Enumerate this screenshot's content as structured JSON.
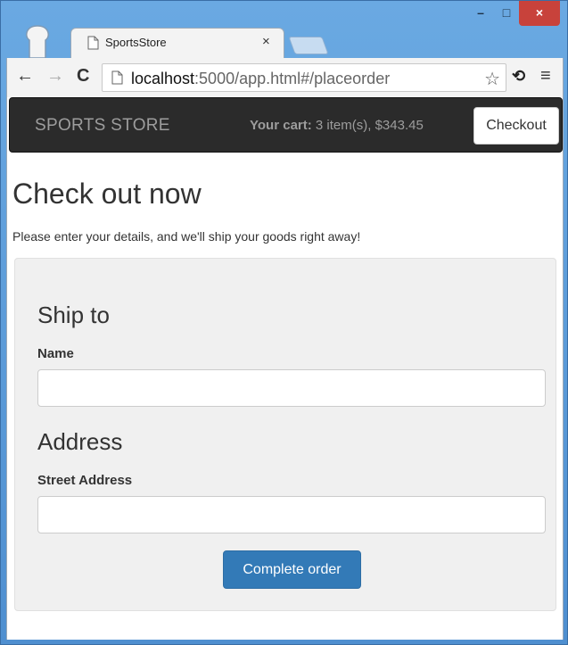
{
  "browser": {
    "tab_title": "SportsStore",
    "tab_close": "×",
    "url_host": "localhost",
    "url_path": ":5000/app.html#/placeorder",
    "window_close": "×",
    "window_min": "–",
    "window_max": "□"
  },
  "icons": {
    "back": "←",
    "forward": "→",
    "reload": "C",
    "star": "☆",
    "extension": "⟲",
    "menu": "≡"
  },
  "navbar": {
    "brand": "SPORTS STORE",
    "cart_label": "Your cart:",
    "cart_summary": " 3 item(s), $343.45",
    "checkout_label": "Checkout"
  },
  "page": {
    "heading": "Check out now",
    "lead": "Please enter your details, and we'll ship your goods right away!"
  },
  "form": {
    "ship_heading": "Ship to",
    "name_label": "Name",
    "name_value": "",
    "address_heading": "Address",
    "street_label": "Street Address",
    "street_value": "",
    "submit_label": "Complete order"
  },
  "colors": {
    "primary": "#337ab7",
    "navbar_bg": "#2b2b2b",
    "close_button": "#c8423b"
  }
}
